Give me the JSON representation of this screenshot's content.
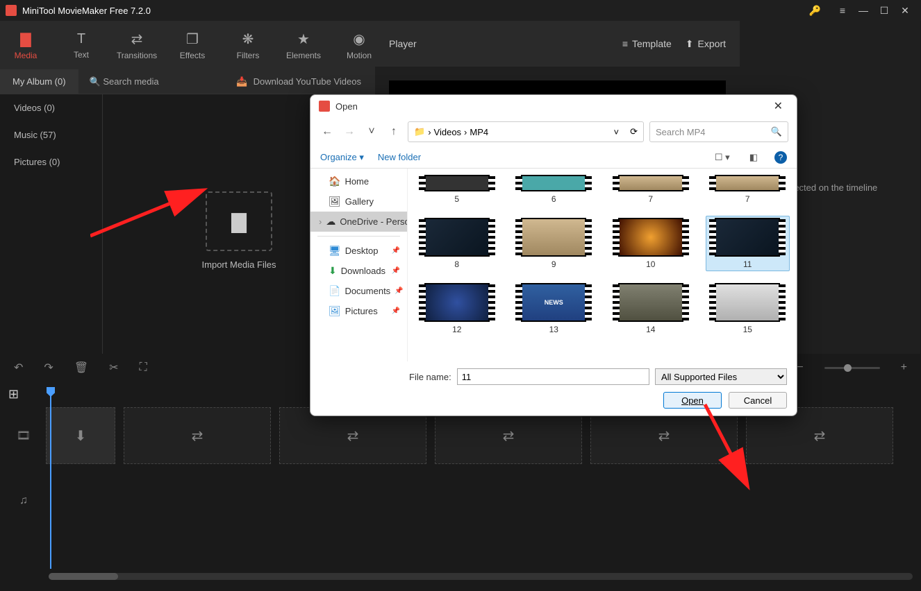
{
  "titlebar": {
    "app_name": "MiniTool MovieMaker Free 7.2.0"
  },
  "toolbar": {
    "media": "Media",
    "text": "Text",
    "transitions": "Transitions",
    "effects": "Effects",
    "filters": "Filters",
    "elements": "Elements",
    "motion": "Motion"
  },
  "subbar": {
    "album": "My Album (0)",
    "search_ph": "Search media",
    "download": "Download YouTube Videos"
  },
  "sidebar": {
    "videos": "Videos (0)",
    "music": "Music (57)",
    "pictures": "Pictures (0)"
  },
  "import_label": "Import Media Files",
  "player": {
    "title": "Player",
    "template": "Template",
    "export": "Export"
  },
  "props_hint": "selected on the timeline",
  "dialog": {
    "title": "Open",
    "crumb1": "Videos",
    "crumb2": "MP4",
    "search_ph": "Search MP4",
    "organize": "Organize",
    "newfolder": "New folder",
    "nav": {
      "home": "Home",
      "gallery": "Gallery",
      "onedrive": "OneDrive - Perso",
      "desktop": "Desktop",
      "downloads": "Downloads",
      "documents": "Documents",
      "pictures": "Pictures"
    },
    "files": [
      "5",
      "6",
      "7",
      "7",
      "8",
      "9",
      "10",
      "11",
      "12",
      "13",
      "14",
      "15"
    ],
    "fn_label": "File name:",
    "fn_value": "11",
    "filter": "All Supported Files",
    "open": "Open",
    "cancel": "Cancel"
  }
}
